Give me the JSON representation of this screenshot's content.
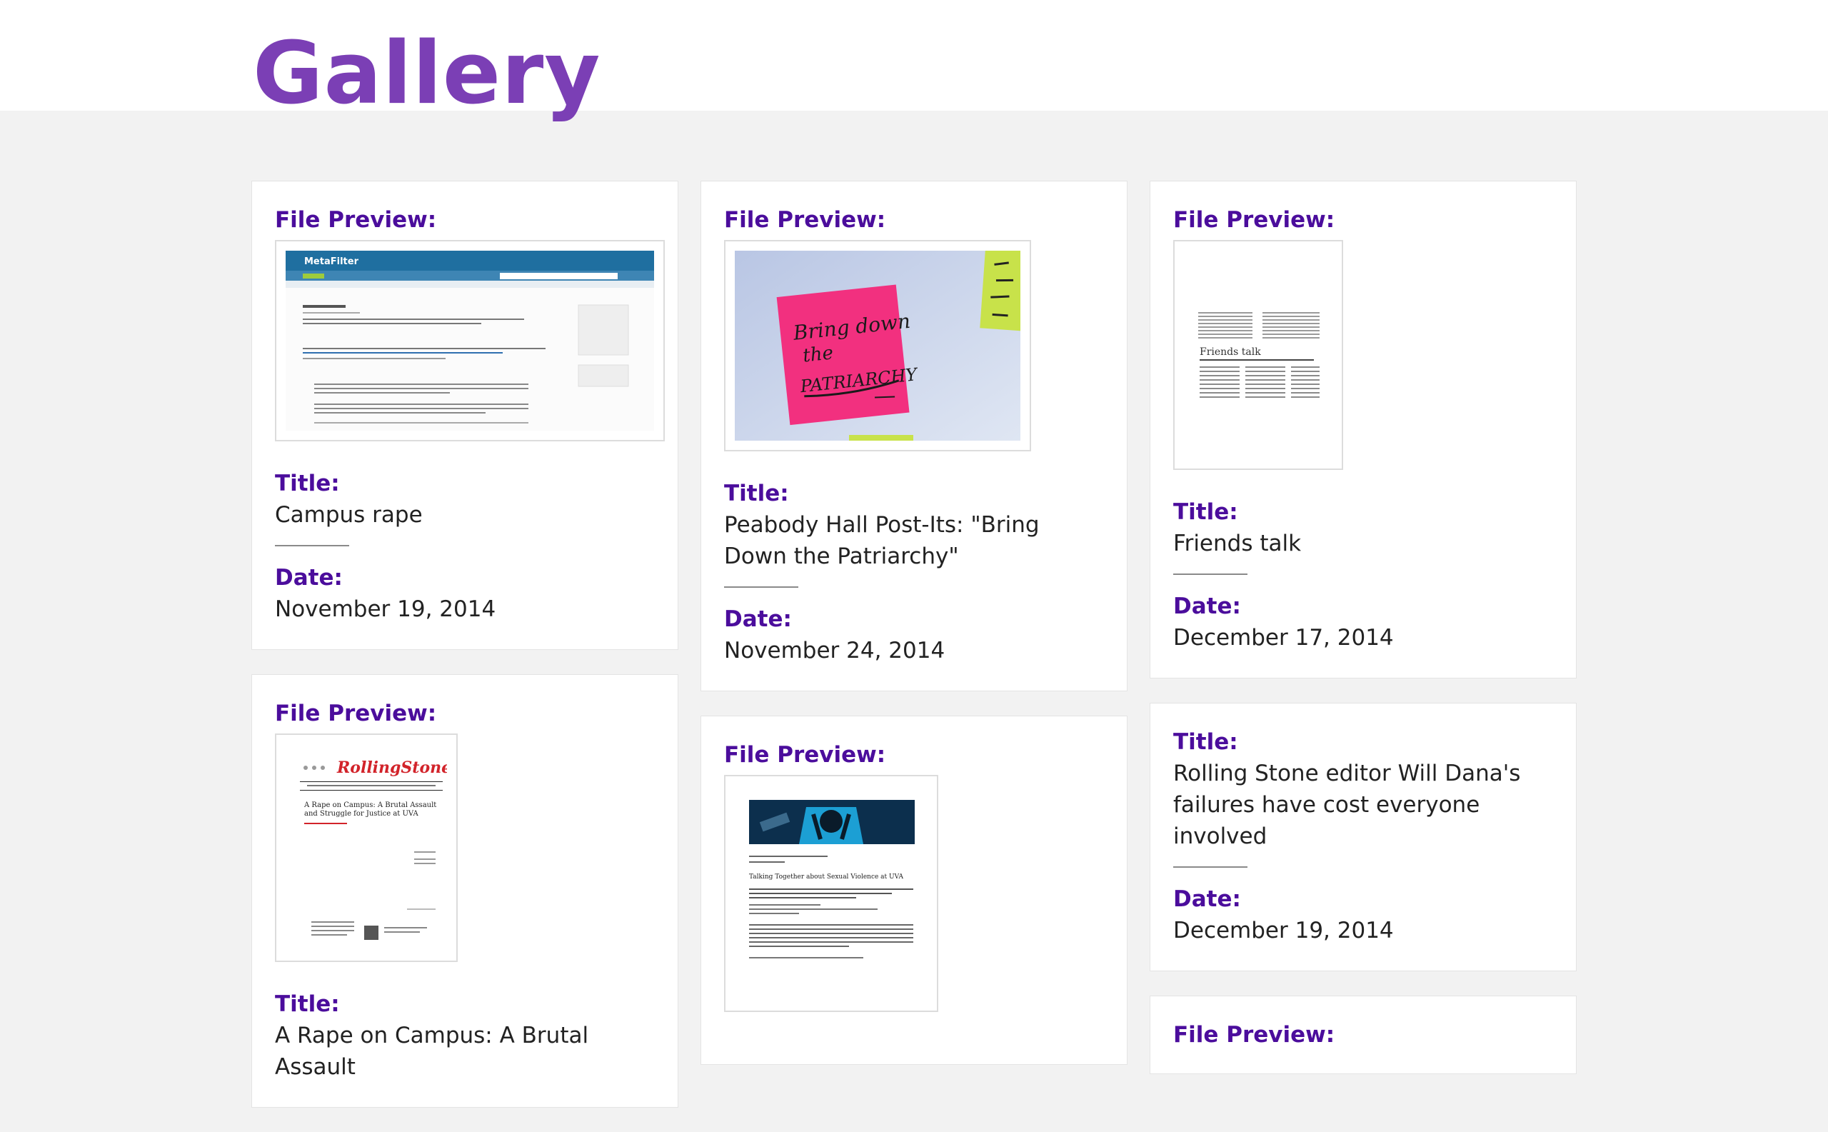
{
  "page": {
    "title": "Gallery"
  },
  "labels": {
    "file_preview": "File Preview:",
    "title": "Title:",
    "date": "Date:"
  },
  "items": [
    {
      "title": "Campus rape",
      "date": "November 19, 2014",
      "preview": "metafilter-webpage-screenshot"
    },
    {
      "title": "Peabody Hall Post-Its: \"Bring Down the Patriarchy\"",
      "date": "November 24, 2014",
      "preview": "pink-post-it-photo",
      "postit_text": [
        "Bring down",
        "the",
        "PATRIARCHY"
      ]
    },
    {
      "title": "Friends talk",
      "date": "December 17, 2014",
      "preview": "newspaper-page-scan",
      "scan_heading": "Friends talk"
    },
    {
      "title": "A Rape on Campus: A Brutal Assault",
      "date": "",
      "preview": "rolling-stone-article-screenshot",
      "scan_logo": "RollingStone",
      "scan_heading": "A Rape on Campus: A Brutal Assault and Struggle for Justice at UVA"
    },
    {
      "title": "",
      "date": "",
      "preview": "event-flyer-scan",
      "scan_heading": "Talking Together about Sexual Violence at UVA"
    },
    {
      "title": "Rolling Stone editor Will Dana's failures have cost everyone involved",
      "date": "December 19, 2014",
      "preview": ""
    },
    {
      "title": "",
      "date": "",
      "preview": ""
    }
  ],
  "colors": {
    "accent": "#7b3fb5",
    "label": "#4b0d9c",
    "background": "#f2f2f2",
    "card": "#ffffff"
  }
}
